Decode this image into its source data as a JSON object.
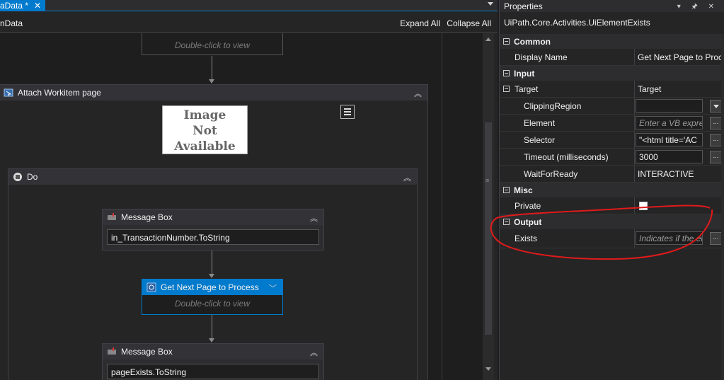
{
  "tab": {
    "title": "aData *",
    "close": "✕"
  },
  "breadcrumb": "nData",
  "toolbar": {
    "expand_all": "Expand All",
    "collapse_all": "Collapse All"
  },
  "canvas": {
    "top_ghost": "Double-click to view",
    "attach": {
      "title": "Attach Workitem page",
      "image_placeholder": [
        "Image",
        "Not",
        "Available"
      ]
    },
    "do": {
      "title": "Do"
    },
    "message_box_1": {
      "title": "Message Box",
      "text": "in_TransactionNumber.ToString"
    },
    "get_next": {
      "title": "Get Next Page to Process",
      "ghost": "Double-click to view"
    },
    "message_box_2": {
      "title": "Message Box",
      "text": "pageExists.ToString"
    }
  },
  "properties": {
    "title": "Properties",
    "subtitle": "UiPath.Core.Activities.UiElementExists",
    "categories": {
      "common": "Common",
      "input": "Input",
      "misc": "Misc",
      "output": "Output"
    },
    "rows": {
      "display_name": {
        "name": "Display Name",
        "value": "Get Next Page to Process"
      },
      "target": {
        "name": "Target",
        "value": "Target"
      },
      "clipping_region": {
        "name": "ClippingRegion",
        "value": ""
      },
      "element": {
        "name": "Element",
        "placeholder": "Enter a VB expression"
      },
      "selector": {
        "name": "Selector",
        "value": "\"<html title='AC"
      },
      "timeout": {
        "name": "Timeout (milliseconds)",
        "value": "3000"
      },
      "wait_for_ready": {
        "name": "WaitForReady",
        "value": "INTERACTIVE"
      },
      "private": {
        "name": "Private"
      },
      "exists": {
        "name": "Exists",
        "placeholder": "Indicates if the element exists"
      }
    },
    "ellipsis": "..."
  },
  "colors": {
    "accent": "#007acc",
    "annotation": "#e01a1a"
  }
}
